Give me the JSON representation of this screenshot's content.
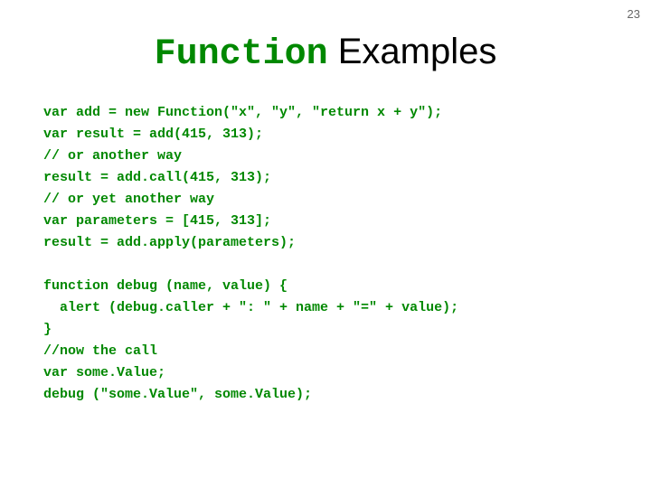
{
  "page_number": "23",
  "title": {
    "mono": "Function",
    "regular": " Examples"
  },
  "code_block_1": "var add = new Function(\"x\", \"y\", \"return x + y\");\nvar result = add(415, 313);\n// or another way\nresult = add.call(415, 313);\n// or yet another way\nvar parameters = [415, 313];\nresult = add.apply(parameters);",
  "code_block_2": "function debug (name, value) {\n  alert (debug.caller + \": \" + name + \"=\" + value);\n}\n//now the call\nvar some.Value;\ndebug (\"some.Value\", some.Value);"
}
